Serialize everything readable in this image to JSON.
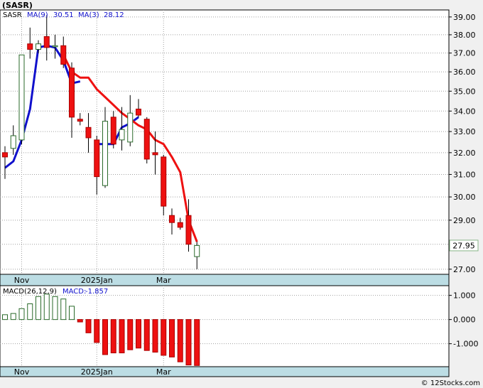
{
  "chart_data": [
    {
      "type": "candlestick",
      "title": "(SASR)",
      "legend": [
        {
          "label": "SASR",
          "color": "#2a6a2a"
        },
        {
          "label": "MA(9)",
          "value": "30.51",
          "color": "#1010cc"
        },
        {
          "label": "MA(3)",
          "value": "28.12",
          "color": "#1010cc"
        }
      ],
      "ylim": [
        26.8,
        39.4
      ],
      "yscale": "log",
      "yticks": [
        "39.00",
        "38.00",
        "37.00",
        "36.00",
        "35.00",
        "34.00",
        "33.00",
        "32.00",
        "31.00",
        "30.00",
        "29.00",
        "28.00",
        "27.00"
      ],
      "ytick_values": [
        39,
        38,
        37,
        36,
        35,
        34,
        33,
        32,
        31,
        30,
        29,
        28,
        27
      ],
      "last_price": "27.95",
      "x_labels": [
        {
          "text": "Nov",
          "index": 2
        },
        {
          "text": "2025Jan",
          "index": 11
        },
        {
          "text": "Mar",
          "index": 19
        }
      ],
      "candles": [
        {
          "o": 32.0,
          "h": 32.3,
          "l": 30.8,
          "c": 31.8
        },
        {
          "o": 32.2,
          "h": 33.3,
          "l": 31.9,
          "c": 32.8
        },
        {
          "o": 32.6,
          "h": 35.3,
          "l": 32.4,
          "c": 36.9
        },
        {
          "o": 37.5,
          "h": 38.4,
          "l": 36.7,
          "c": 37.2
        },
        {
          "o": 37.2,
          "h": 37.7,
          "l": 37.0,
          "c": 37.5
        },
        {
          "o": 37.9,
          "h": 39.1,
          "l": 36.6,
          "c": 37.3
        },
        {
          "o": 37.4,
          "h": 38.0,
          "l": 36.7,
          "c": 37.4
        },
        {
          "o": 37.4,
          "h": 37.9,
          "l": 36.2,
          "c": 36.4
        },
        {
          "o": 36.2,
          "h": 36.5,
          "l": 32.7,
          "c": 33.7
        },
        {
          "o": 33.6,
          "h": 33.9,
          "l": 33.3,
          "c": 33.5
        },
        {
          "o": 33.2,
          "h": 33.9,
          "l": 32.0,
          "c": 32.7
        },
        {
          "o": 32.6,
          "h": 32.8,
          "l": 30.1,
          "c": 30.9
        },
        {
          "o": 30.5,
          "h": 34.2,
          "l": 30.4,
          "c": 33.5
        },
        {
          "o": 33.7,
          "h": 34.0,
          "l": 32.2,
          "c": 32.4
        },
        {
          "o": 32.6,
          "h": 34.2,
          "l": 32.1,
          "c": 33.1
        },
        {
          "o": 32.5,
          "h": 34.8,
          "l": 32.3,
          "c": 33.9
        },
        {
          "o": 34.1,
          "h": 34.6,
          "l": 33.7,
          "c": 33.8
        },
        {
          "o": 33.6,
          "h": 33.7,
          "l": 31.5,
          "c": 31.7
        },
        {
          "o": 32.0,
          "h": 33.0,
          "l": 31.0,
          "c": 31.9
        },
        {
          "o": 31.8,
          "h": 31.9,
          "l": 29.2,
          "c": 29.6
        },
        {
          "o": 29.2,
          "h": 29.5,
          "l": 28.4,
          "c": 28.9
        },
        {
          "o": 28.9,
          "h": 29.1,
          "l": 28.6,
          "c": 28.7
        },
        {
          "o": 29.2,
          "h": 29.9,
          "l": 27.7,
          "c": 28.0
        },
        {
          "o": 27.5,
          "h": 28.1,
          "l": 27.0,
          "c": 27.95
        }
      ],
      "series": [
        {
          "name": "MA(9)",
          "color": "#1010cc",
          "values": [
            31.3,
            31.6,
            32.6,
            34.1,
            37.3,
            37.4,
            37.3,
            36.6,
            35.4,
            35.5,
            null,
            32.4,
            32.4,
            32.4,
            33.2,
            33.4,
            33.7,
            null,
            null,
            null,
            null,
            null,
            null,
            null
          ]
        },
        {
          "name": "MA(3)",
          "color": "#ee1111",
          "values": [
            null,
            null,
            null,
            null,
            null,
            null,
            null,
            36.9,
            36.0,
            35.7,
            35.7,
            35.1,
            34.7,
            34.3,
            33.9,
            33.6,
            33.3,
            33.1,
            32.6,
            32.4,
            31.8,
            31.1,
            29.0,
            28.1
          ]
        }
      ]
    },
    {
      "type": "bar",
      "title": "MACD(26,12,9)",
      "label": "MACD:",
      "value_text": "-1.857",
      "ylim": [
        -1.95,
        1.4
      ],
      "yticks": [
        "1.000",
        "0.000",
        "-1.000"
      ],
      "ytick_values": [
        1.0,
        0.0,
        -1.0
      ],
      "x_labels": [
        {
          "text": "Nov",
          "index": 2
        },
        {
          "text": "2025Jan",
          "index": 11
        },
        {
          "text": "Mar",
          "index": 19
        }
      ],
      "values": [
        0.2,
        0.25,
        0.45,
        0.65,
        0.95,
        1.05,
        0.95,
        0.85,
        0.55,
        -0.1,
        -0.55,
        -0.95,
        -1.45,
        -1.38,
        -1.38,
        -1.25,
        -1.18,
        -1.28,
        -1.35,
        -1.48,
        -1.55,
        -1.75,
        -1.88,
        -1.9
      ]
    }
  ],
  "footer": {
    "text": "© 12Stocks.com"
  }
}
